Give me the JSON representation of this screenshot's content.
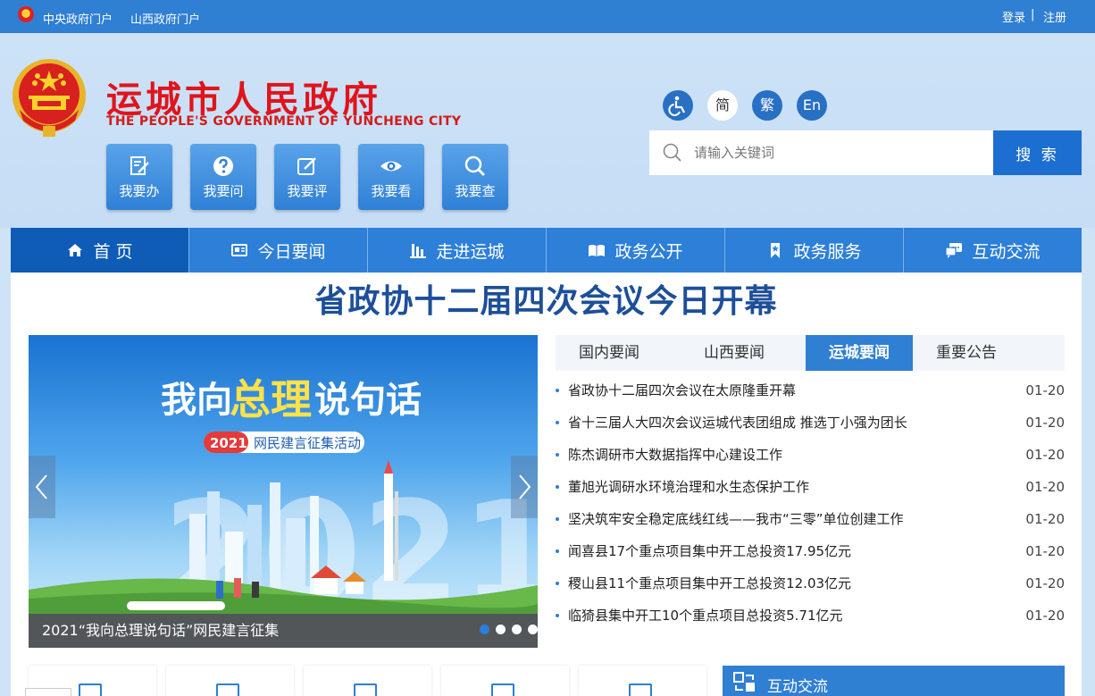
{
  "topbar": {
    "link1": "中央政府门户",
    "link2": "山西政府门户",
    "login": "登录",
    "sep": "|",
    "register": "注册"
  },
  "header": {
    "title": "运城市人民政府",
    "subtitle": "THE PEOPLE'S GOVERNMENT OF YUNCHENG  CITY"
  },
  "quick_buttons": [
    {
      "label": "我要办",
      "icon": "edit-doc-icon"
    },
    {
      "label": "我要问",
      "icon": "question-icon"
    },
    {
      "label": "我要评",
      "icon": "pencil-square-icon"
    },
    {
      "label": "我要看",
      "icon": "eye-icon"
    },
    {
      "label": "我要查",
      "icon": "search-icon"
    }
  ],
  "access": {
    "accessibility_icon": "wheelchair-icon",
    "simplified": "简",
    "traditional": "繁",
    "english": "En"
  },
  "search": {
    "placeholder": "请输入关键词",
    "button": "搜 索"
  },
  "nav": [
    {
      "label": "首 页",
      "icon": "home-icon"
    },
    {
      "label": "今日要闻",
      "icon": "news-icon"
    },
    {
      "label": "走进运城",
      "icon": "building-icon"
    },
    {
      "label": "政务公开",
      "icon": "book-icon"
    },
    {
      "label": "政务服务",
      "icon": "bookmark-icon"
    },
    {
      "label": "互动交流",
      "icon": "chat-icon"
    }
  ],
  "headline": "省政协十二届四次会议今日开幕",
  "slide": {
    "title_a": "我向",
    "title_b": "总理",
    "title_c": "说句话",
    "badge_year": "2021",
    "badge_text": "网民建言征集活动",
    "caption": "2021“我向总理说句话”网民建言征集",
    "dot_count": 5,
    "active_dot": 1
  },
  "tabs": [
    "国内要闻",
    "山西要闻",
    "运城要闻",
    "重要公告"
  ],
  "active_tab": 2,
  "news": [
    {
      "title": "省政协十二届四次会议在太原隆重开幕",
      "date": "01-20"
    },
    {
      "title": "省十三届人大四次会议运城代表团组成 推选丁小强为团长",
      "date": "01-20"
    },
    {
      "title": "陈杰调研市大数据指挥中心建设工作",
      "date": "01-20"
    },
    {
      "title": "董旭光调研水环境治理和水生态保护工作",
      "date": "01-20"
    },
    {
      "title": "坚决筑牢安全稳定底线红线——我市“三零”单位创建工作",
      "date": "01-20"
    },
    {
      "title": "闻喜县17个重点项目集中开工总投资17.95亿元",
      "date": "01-20"
    },
    {
      "title": "稷山县11个重点项目集中开工总投资12.03亿元",
      "date": "01-20"
    },
    {
      "title": "临猗县集中开工10个重点项目总投资5.71亿元",
      "date": "01-20"
    }
  ],
  "bottom": {
    "hudong": "互动交流"
  },
  "colors": {
    "topbar": "#2f7fd3",
    "nav": "#2d7fd8",
    "nav_active": "#0e5cb6",
    "title_red": "#e0141c",
    "headline_blue": "#1d4f99"
  }
}
